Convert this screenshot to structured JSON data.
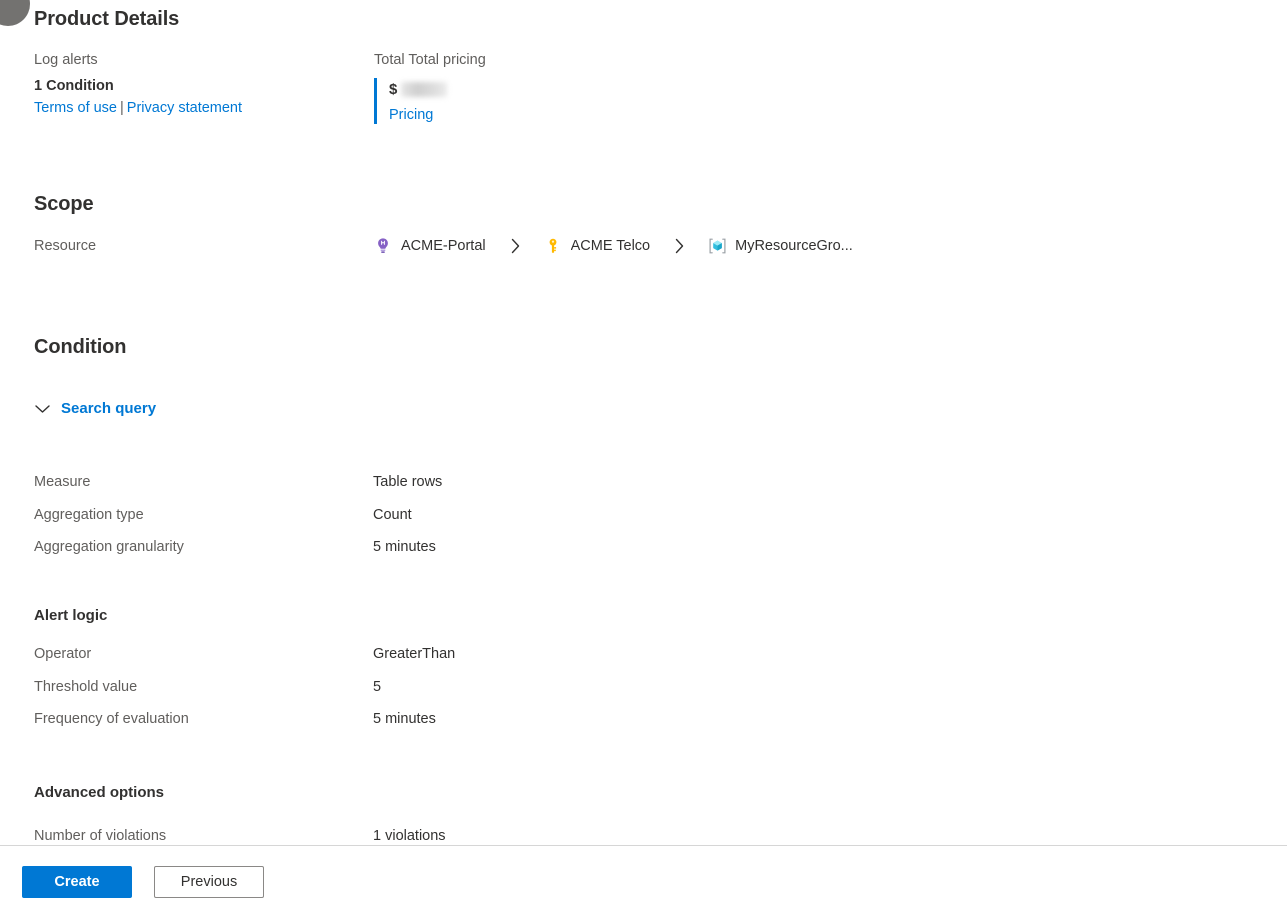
{
  "product_details": {
    "title": "Product Details",
    "left": {
      "heading": "Log alerts",
      "value": "1 Condition",
      "terms_link": "Terms of use",
      "separator": "|",
      "privacy_link": "Privacy statement"
    },
    "right": {
      "heading": "Total Total pricing",
      "currency": "$",
      "amount_redacted": "",
      "pricing_link": "Pricing"
    }
  },
  "scope": {
    "title": "Scope",
    "resource_label": "Resource",
    "breadcrumb": [
      {
        "label": "ACME-Portal",
        "icon": "subscription-bulb-icon"
      },
      {
        "label": "ACME Telco",
        "icon": "key-icon"
      },
      {
        "label": "MyResourceGro...",
        "icon": "resource-group-icon"
      }
    ],
    "separator_icon": "chevron-right-icon"
  },
  "condition": {
    "title": "Condition",
    "search_query_label": "Search query",
    "search_query_chevron": "chevron-down-icon",
    "rows": [
      {
        "label": "Measure",
        "value": "Table rows"
      },
      {
        "label": "Aggregation type",
        "value": "Count"
      },
      {
        "label": "Aggregation granularity",
        "value": "5 minutes"
      }
    ]
  },
  "alert_logic": {
    "title": "Alert logic",
    "rows": [
      {
        "label": "Operator",
        "value": "GreaterThan"
      },
      {
        "label": "Threshold value",
        "value": "5"
      },
      {
        "label": "Frequency of evaluation",
        "value": "5 minutes"
      }
    ]
  },
  "advanced_options": {
    "title": "Advanced options",
    "rows": [
      {
        "label": "Number of violations",
        "value": "1 violations"
      }
    ]
  },
  "footer": {
    "create_label": "Create",
    "previous_label": "Previous"
  },
  "colors": {
    "accent": "#0078d4",
    "text_primary": "#323130",
    "text_secondary": "#605e5c",
    "divider": "#d6d6d6",
    "key_icon": "#ffb900",
    "bulb_icon": "#8661c5",
    "resource_group_icon": "#32bedd"
  }
}
